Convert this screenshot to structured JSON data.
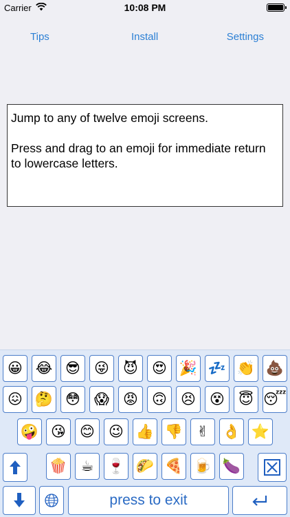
{
  "status_bar": {
    "carrier": "Carrier",
    "time": "10:08 PM"
  },
  "nav": {
    "tips": "Tips",
    "install": "Install",
    "settings": "Settings"
  },
  "textbox": {
    "line1": "Jump to any of twelve emoji screens.",
    "line2": "Press and drag to an emoji for immediate return to lowercase letters."
  },
  "keyboard": {
    "row1": [
      "😀",
      "😂",
      "😎",
      "😜",
      "😈",
      "😍",
      "🎉",
      "💤",
      "👏",
      "💩"
    ],
    "row2": [
      "😖",
      "🤔",
      "😳",
      "😱",
      "😡",
      "🙃",
      "😣",
      "😵",
      "😇",
      "😴"
    ],
    "row3": [
      "🤪",
      "😘",
      "😊",
      "😉",
      "👍",
      "👎",
      "✌",
      "👌",
      "⭐"
    ],
    "row4": [
      "🍿",
      "☕",
      "🍷",
      "🌮",
      "🍕",
      "🍺",
      "🍆"
    ],
    "press_to_exit": "press to exit",
    "colors": {
      "accent": "#4a7cc9",
      "link": "#2b7fd4",
      "background": "#dfe9f8"
    }
  }
}
